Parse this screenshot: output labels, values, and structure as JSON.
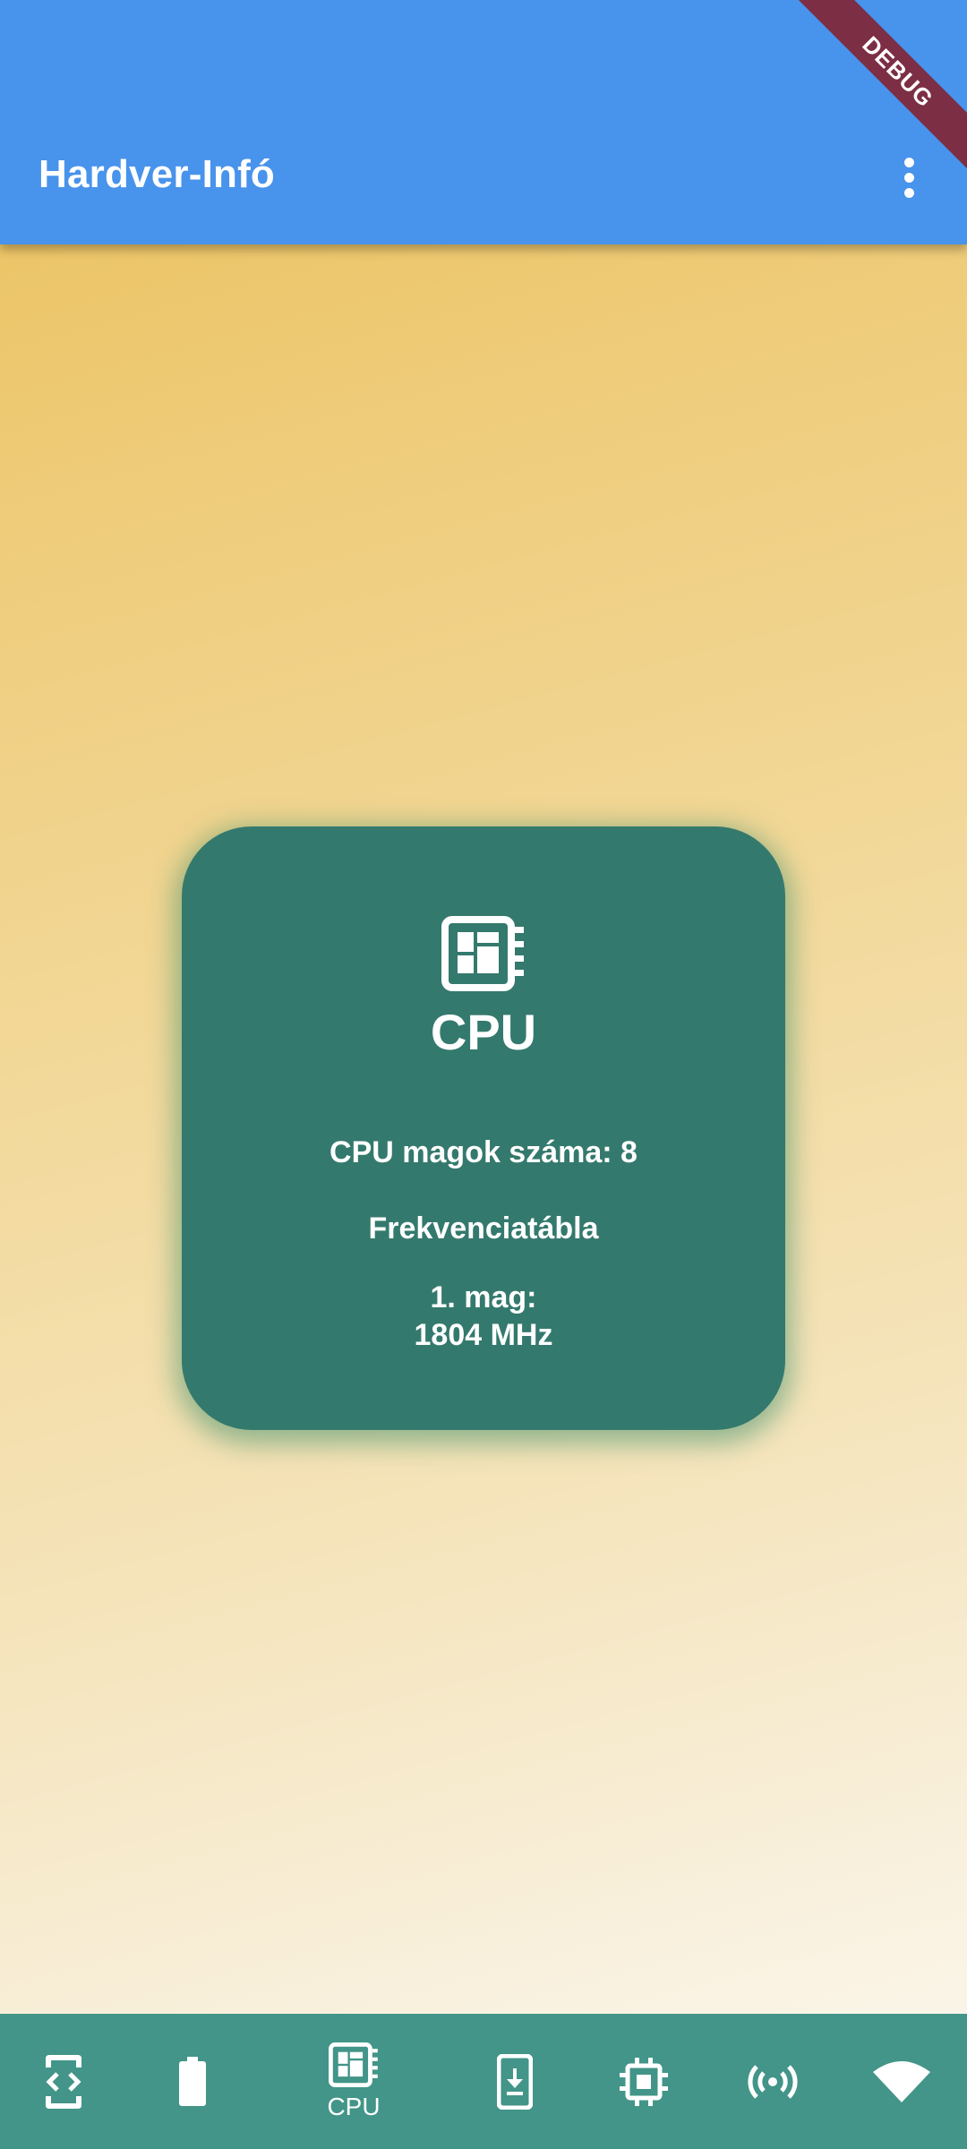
{
  "app_bar": {
    "title": "Hardver-Infó",
    "menu_icon": "more-vert-icon",
    "background": "#4893EB"
  },
  "debug_banner": {
    "label": "DEBUG",
    "color": "#7C2E45"
  },
  "card": {
    "icon": "cpu-dashboard-icon",
    "title": "CPU",
    "cores_text": "CPU magok száma: 8",
    "freq_table_title": "Frekvenciatábla",
    "core_label": "1. mag:",
    "core_value": "1804 MHz",
    "background": "#34796D"
  },
  "bottom_nav": {
    "background": "#429588",
    "items": [
      {
        "icon": "developer-mode-icon",
        "label": ""
      },
      {
        "icon": "battery-icon",
        "label": ""
      },
      {
        "icon": "cpu-icon",
        "label": "CPU",
        "selected": true
      },
      {
        "icon": "download-phone-icon",
        "label": ""
      },
      {
        "icon": "memory-chip-icon",
        "label": ""
      },
      {
        "icon": "wireless-signal-icon",
        "label": ""
      },
      {
        "icon": "wifi-icon",
        "label": ""
      }
    ]
  }
}
